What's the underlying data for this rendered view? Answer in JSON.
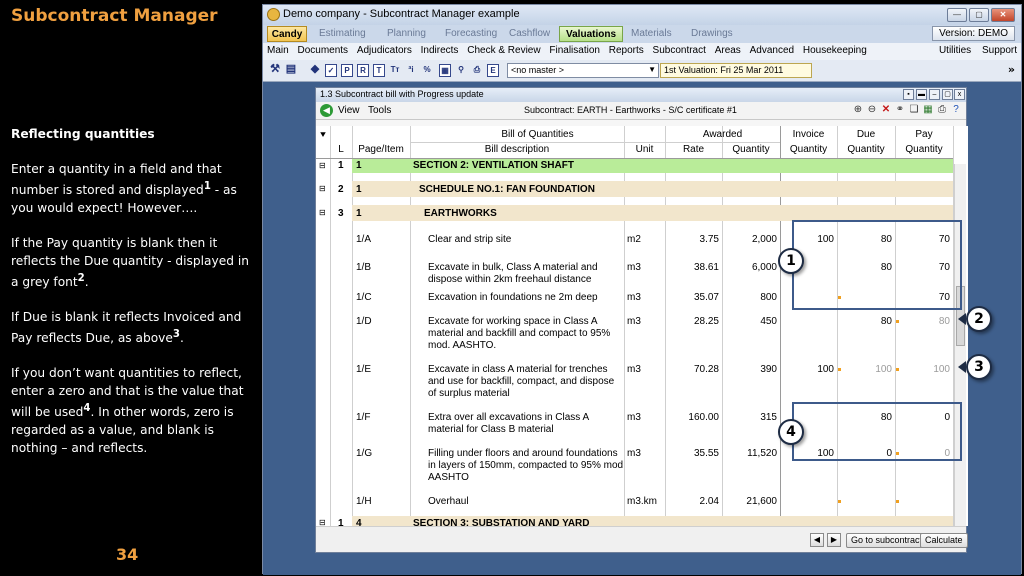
{
  "slide": {
    "title": "Subcontract Manager",
    "heading": "Reflecting quantities",
    "p1_a": "Enter a quantity in a field and  that number is stored and displayed",
    "p1_sup": "1",
    "p1_b": " - as you would expect!  However….",
    "p2_a": "If the Pay quantity is blank then it reflects the Due quantity - displayed in a grey font",
    "p2_sup": "2",
    "p2_b": ".",
    "p3_a": "If Due is blank it reflects Invoiced and Pay reflects Due, as above",
    "p3_sup": "3",
    "p3_b": ".",
    "p4_a": "If you don’t want quantities to reflect, enter a zero and that is the value that will be used",
    "p4_sup": "4",
    "p4_b": ".  In other words, zero is regarded as a value, and blank is nothing – and reflects.",
    "page_number": "34"
  },
  "window": {
    "title": "Demo company - Subcontract Manager example",
    "version_button": "Version: DEMO",
    "tabs": [
      "Candy",
      "Estimating",
      "Planning",
      "Forecasting",
      "Cashflow",
      "Valuations",
      "Materials",
      "Drawings"
    ],
    "menu": [
      "Main",
      "Documents",
      "Adjudicators",
      "Indirects",
      "Check & Review",
      "Finalisation",
      "Reports",
      "Subcontract",
      "Areas",
      "Advanced",
      "Housekeeping"
    ],
    "menu_right": [
      "Utilities",
      "Support"
    ],
    "toolbar": {
      "master_select": "<no master >",
      "valuation": "1st Valuation: Fri 25 Mar 2011"
    }
  },
  "child": {
    "title": "1.3 Subcontract bill with Progress update",
    "menu": [
      "View",
      "Tools"
    ],
    "subtitle": "Subcontract: EARTH - Earthworks - S/C certificate #1",
    "headers": {
      "l": "L",
      "page_item": "Page/Item",
      "bill_group": "Bill of Quantities",
      "bill_desc": "Bill description",
      "unit": "Unit",
      "awarded_group": "Awarded",
      "rate": "Rate",
      "quantity": "Quantity",
      "invoice_top": "Invoice",
      "invoice_bottom": "Quantity",
      "due_top": "Due",
      "due_bottom": "Quantity",
      "pay_top": "Pay",
      "pay_bottom": "Quantity"
    },
    "rows": [
      {
        "l": "1",
        "item": "1",
        "desc": "SECTION 2: VENTILATION SHAFT"
      },
      {
        "l": "2",
        "item": "1",
        "desc": "SCHEDULE NO.1: FAN FOUNDATION"
      },
      {
        "l": "3",
        "item": "1",
        "desc": "EARTHWORKS"
      },
      {
        "item": "1/A",
        "desc": "Clear and strip site",
        "unit": "m2",
        "rate": "3.75",
        "qty": "2,000",
        "inv": "100",
        "due": "80",
        "pay": "70"
      },
      {
        "item": "1/B",
        "desc": "Excavate in bulk, Class A material and dispose within 2km freehaul distance",
        "unit": "m3",
        "rate": "38.61",
        "qty": "6,000",
        "inv": "",
        "due": "80",
        "pay": "70"
      },
      {
        "item": "1/C",
        "desc": "Excavation in foundations ne 2m deep",
        "unit": "m3",
        "rate": "35.07",
        "qty": "800",
        "inv": "",
        "due": "",
        "pay": "70"
      },
      {
        "item": "1/D",
        "desc": "Excavate for working space in Class A material and backfill and compact to 95% mod. AASHTO.",
        "unit": "m3",
        "rate": "28.25",
        "qty": "450",
        "inv": "",
        "due": "80",
        "pay": "80"
      },
      {
        "item": "1/E",
        "desc": "Excavate in class A material for trenches and use for backfill, compact, and dispose of surplus material",
        "unit": "m3",
        "rate": "70.28",
        "qty": "390",
        "inv": "100",
        "due": "100",
        "pay": "100"
      },
      {
        "item": "1/F",
        "desc": "Extra over all excavations in Class A material for Class B material",
        "unit": "m3",
        "rate": "160.00",
        "qty": "315",
        "inv": "",
        "due": "80",
        "pay": "0"
      },
      {
        "item": "1/G",
        "desc": "Filling under floors and around foundations in layers of 150mm, compacted to 95% mod AASHTO",
        "unit": "m3",
        "rate": "35.55",
        "qty": "11,520",
        "inv": "100",
        "due": "0",
        "pay": "0"
      },
      {
        "item": "1/H",
        "desc": "Overhaul",
        "unit": "m3.km",
        "rate": "2.04",
        "qty": "21,600",
        "inv": "",
        "due": "",
        "pay": ""
      },
      {
        "l": "1",
        "item": "4",
        "desc": "SECTION 3: SUBSTATION AND YARD"
      }
    ],
    "buttons": {
      "goto": "Go to subcontract",
      "calculate": "Calculate"
    }
  },
  "callouts": [
    "1",
    "2",
    "3",
    "4"
  ],
  "colors": {
    "title_orange": "#f0a040",
    "section_green": "#b9ec99",
    "schedule_beige": "#f2e6cc",
    "callout_box": "#3d5a8a"
  }
}
